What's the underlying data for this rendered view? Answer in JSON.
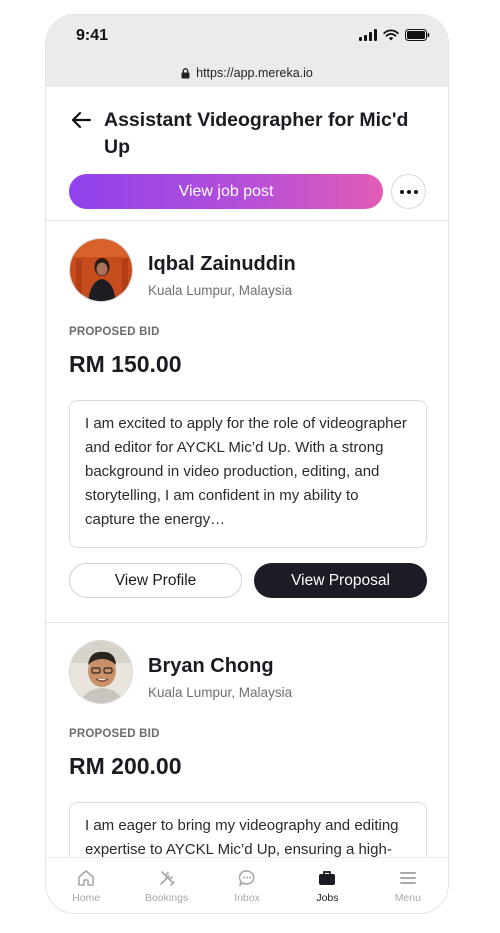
{
  "status": {
    "time": "9:41"
  },
  "browser": {
    "url": "https://app.mereka.io"
  },
  "header": {
    "title": "Assistant Videographer for Mic'd Up",
    "view_job_label": "View job post"
  },
  "applicants": [
    {
      "name": "Iqbal Zainuddin",
      "location": "Kuala Lumpur, Malaysia",
      "bid_label": "PROPOSED BID",
      "bid_amount": "RM 150.00",
      "proposal": "I am excited to apply for the role of videographer and editor for AYCKL Mic’d Up. With a strong background in video production, editing, and storytelling, I am confident in my ability to capture the energy…",
      "view_profile_label": "View Profile",
      "view_proposal_label": "View Proposal"
    },
    {
      "name": "Bryan Chong",
      "location": "Kuala Lumpur, Malaysia",
      "bid_label": "PROPOSED BID",
      "bid_amount": "RM 200.00",
      "proposal": "I am eager to bring my videography and editing expertise to AYCKL Mic’d Up, ensuring a high-quality production that captures the"
    }
  ],
  "tabs": [
    {
      "label": "Home",
      "icon": "home-icon"
    },
    {
      "label": "Bookings",
      "icon": "tools-icon"
    },
    {
      "label": "Inbox",
      "icon": "chat-icon"
    },
    {
      "label": "Jobs",
      "icon": "briefcase-icon",
      "active": true
    },
    {
      "label": "Menu",
      "icon": "menu-icon"
    }
  ],
  "colors": {
    "gradient_start": "#8f42ec",
    "gradient_end": "#e15db5",
    "dark_button": "#1d1b26",
    "muted_text": "#6f6f75"
  }
}
